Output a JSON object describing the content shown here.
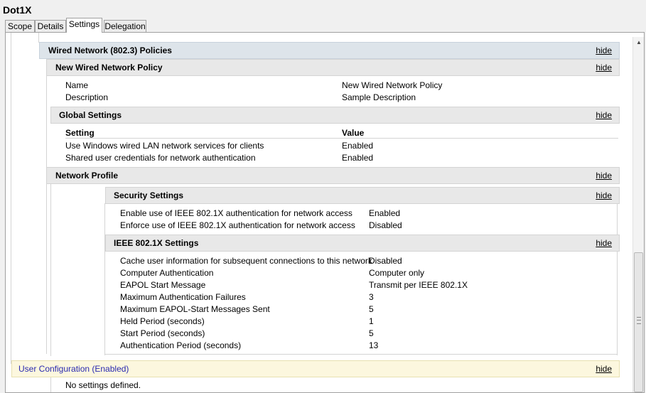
{
  "window": {
    "title": "Dot1X"
  },
  "tabs": [
    {
      "label": "Scope"
    },
    {
      "label": "Details"
    },
    {
      "label": "Settings"
    },
    {
      "label": "Delegation"
    }
  ],
  "active_tab": "Settings",
  "hide_label": "hide",
  "wired_policies": {
    "title": "Wired Network (802.3) Policies",
    "policy": {
      "title": "New Wired Network Policy",
      "rows": [
        {
          "label": "Name",
          "value": "New Wired Network Policy"
        },
        {
          "label": "Description",
          "value": "Sample Description"
        }
      ]
    },
    "global_settings": {
      "title": "Global Settings",
      "col_setting": "Setting",
      "col_value": "Value",
      "rows": [
        {
          "label": "Use Windows wired LAN network services for clients",
          "value": "Enabled"
        },
        {
          "label": "Shared user credentials for network authentication",
          "value": "Enabled"
        }
      ]
    },
    "network_profile": {
      "title": "Network Profile",
      "security_settings": {
        "title": "Security Settings",
        "rows": [
          {
            "label": "Enable use of IEEE 802.1X authentication for network access",
            "value": "Enabled"
          },
          {
            "label": "Enforce use of IEEE 802.1X authentication for network access",
            "value": "Disabled"
          }
        ]
      },
      "ieee_settings": {
        "title": "IEEE 802.1X Settings",
        "rows": [
          {
            "label": "Cache user information for subsequent connections to this network",
            "value": "Disabled"
          },
          {
            "label": "Computer Authentication",
            "value": "Computer only"
          },
          {
            "label": "EAPOL Start Message",
            "value": "Transmit per IEEE 802.1X"
          },
          {
            "label": "Maximum Authentication Failures",
            "value": "3"
          },
          {
            "label": "Maximum EAPOL-Start Messages Sent",
            "value": "5"
          },
          {
            "label": "Held Period (seconds)",
            "value": "1"
          },
          {
            "label": "Start Period (seconds)",
            "value": "5"
          },
          {
            "label": "Authentication Period (seconds)",
            "value": "13"
          }
        ]
      }
    }
  },
  "user_configuration": {
    "title": "User Configuration (Enabled)",
    "message": "No settings defined."
  },
  "colors": {
    "user_config_title": "#2a2ab0",
    "blue_header": "#dde4ea",
    "yellow_header": "#fcf7de"
  }
}
